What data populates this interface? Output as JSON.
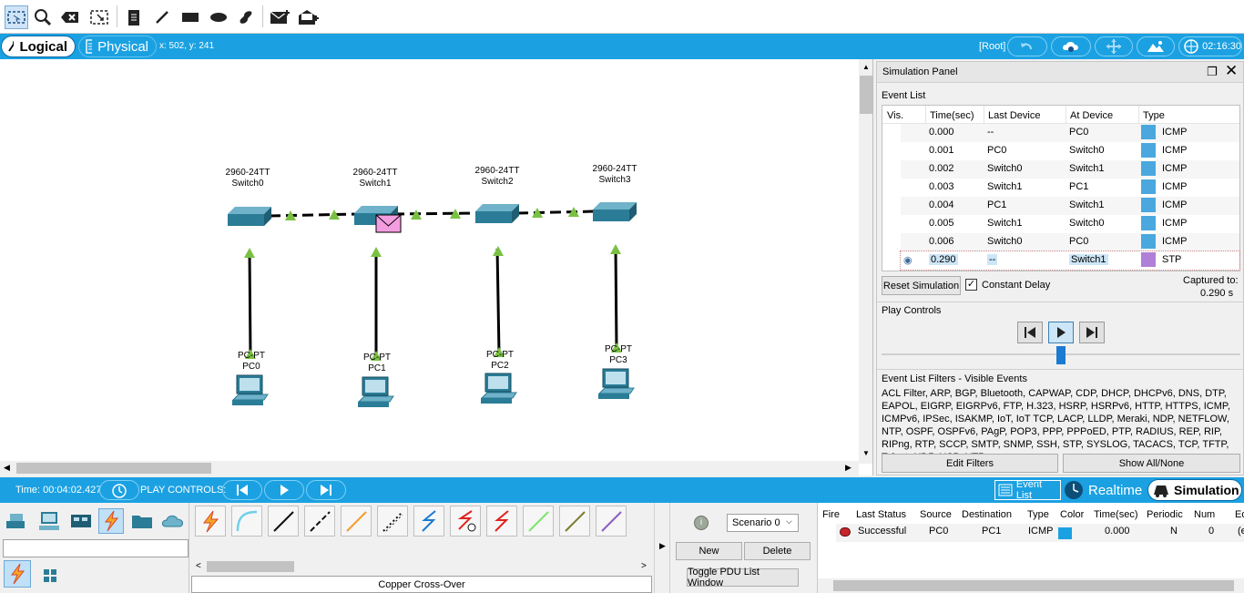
{
  "toolbar": {
    "tools": [
      "select-tool",
      "inspect-tool",
      "delete-tool",
      "resize-tool",
      "note-tool",
      "draw-line-tool",
      "draw-rectangle-tool",
      "draw-ellipse-tool",
      "draw-freeform-tool",
      "add-simple-pdu-tool",
      "add-complex-pdu-tool"
    ]
  },
  "modebar": {
    "logical_label": "Logical",
    "physical_label": "Physical",
    "coords": "x: 502, y: 241",
    "root_label": "[Root]",
    "clock": "02:16:30"
  },
  "network": {
    "switches": [
      {
        "model": "2960-24TT",
        "name": "Switch0"
      },
      {
        "model": "2960-24TT",
        "name": "Switch1"
      },
      {
        "model": "2960-24TT",
        "name": "Switch2"
      },
      {
        "model": "2960-24TT",
        "name": "Switch3"
      }
    ],
    "pcs": [
      {
        "model": "PC-PT",
        "name": "PC0"
      },
      {
        "model": "PC-PT",
        "name": "PC1"
      },
      {
        "model": "PC-PT",
        "name": "PC2"
      },
      {
        "model": "PC-PT",
        "name": "PC3"
      }
    ],
    "link_color": "#7ac143",
    "pdu_color": "#f39de0"
  },
  "sim_panel": {
    "title": "Simulation Panel",
    "event_list_label": "Event List",
    "headers": [
      "Vis.",
      "Time(sec)",
      "Last Device",
      "At Device",
      "Type"
    ],
    "events": [
      {
        "time": "0.000",
        "last": "--",
        "at": "PC0",
        "type": "ICMP",
        "color": "#4aa8de"
      },
      {
        "time": "0.001",
        "last": "PC0",
        "at": "Switch0",
        "type": "ICMP",
        "color": "#4aa8de"
      },
      {
        "time": "0.002",
        "last": "Switch0",
        "at": "Switch1",
        "type": "ICMP",
        "color": "#4aa8de"
      },
      {
        "time": "0.003",
        "last": "Switch1",
        "at": "PC1",
        "type": "ICMP",
        "color": "#4aa8de"
      },
      {
        "time": "0.004",
        "last": "PC1",
        "at": "Switch1",
        "type": "ICMP",
        "color": "#4aa8de"
      },
      {
        "time": "0.005",
        "last": "Switch1",
        "at": "Switch0",
        "type": "ICMP",
        "color": "#4aa8de"
      },
      {
        "time": "0.006",
        "last": "Switch0",
        "at": "PC0",
        "type": "ICMP",
        "color": "#4aa8de"
      },
      {
        "time": "0.290",
        "last": "--",
        "at": "Switch1",
        "type": "STP",
        "color": "#b07fd8"
      }
    ],
    "reset_label": "Reset Simulation",
    "constant_delay_label": "Constant Delay",
    "constant_delay_checked": true,
    "captured_label": "Captured to:",
    "captured_value": "0.290 s",
    "play_controls_label": "Play Controls",
    "filters_title": "Event List Filters - Visible Events",
    "filters_text": "ACL Filter, ARP, BGP, Bluetooth, CAPWAP, CDP, DHCP, DHCPv6, DNS, DTP, EAPOL, EIGRP, EIGRPv6, FTP, H.323, HSRP, HSRPv6, HTTP, HTTPS, ICMP, ICMPv6, IPSec, ISAKMP, IoT, IoT TCP, LACP, LLDP, Meraki, NDP, NETFLOW, NTP, OSPF, OSPFv6, PAgP, POP3, PPP, PPPoED, PTP, RADIUS, REP, RIP, RIPng, RTP, SCCP, SMTP, SNMP, SSH, STP, SYSLOG, TACACS, TCP, TFTP, Telnet, UDP, USB, VTP",
    "edit_filters_label": "Edit Filters",
    "show_all_label": "Show All/None"
  },
  "bottombar": {
    "time": "Time: 00:04:02.427",
    "play_controls": "PLAY CONTROLS:",
    "event_list_label": "Event List",
    "realtime_label": "Realtime",
    "simulation_label": "Simulation"
  },
  "cable_panel": {
    "selected_cable": "Copper Cross-Over"
  },
  "pdu_panel": {
    "scenario": "Scenario 0",
    "new_label": "New",
    "delete_label": "Delete",
    "toggle_label": "Toggle PDU List Window"
  },
  "pdu_table": {
    "headers": [
      "Fire",
      "Last Status",
      "Source",
      "Destination",
      "Type",
      "Color",
      "Time(sec)",
      "Periodic",
      "Num",
      "Ed"
    ],
    "rows": [
      {
        "status": "Successful",
        "source": "PC0",
        "destination": "PC1",
        "type": "ICMP",
        "color": "#1ba1e2",
        "time": "0.000",
        "periodic": "N",
        "num": "0",
        "ed": "(e"
      }
    ]
  }
}
